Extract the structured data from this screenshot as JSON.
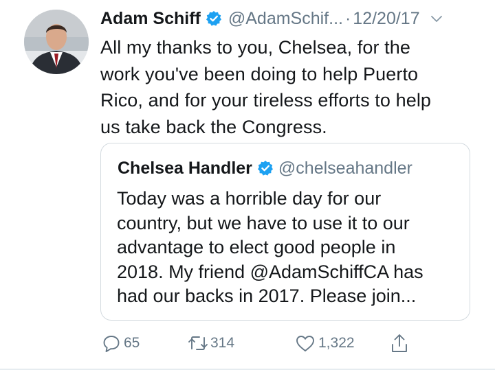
{
  "tweet": {
    "author_name": "Adam Schiff",
    "author_handle": "@AdamSchif...",
    "separator": "·",
    "date": "12/20/17",
    "text": "All my thanks to you, Chelsea, for the\nwork you've been doing to help Puerto\nRico, and for your tireless efforts to help\nus take back the Congress."
  },
  "quoted_tweet": {
    "author_name": "Chelsea Handler",
    "author_handle": "@chelseahandler",
    "text": "Today was a horrible day for our\ncountry, but we have to use it to our\nadvantage to elect good people in\n2018. My friend @AdamSchiffCA has\nhad our backs in 2017. Please join..."
  },
  "actions": {
    "replies": "65",
    "retweets": "314",
    "likes": "1,322"
  },
  "icons": {
    "verified": "verified-badge-icon",
    "caret": "chevron-down-icon",
    "reply": "reply-icon",
    "retweet": "retweet-icon",
    "like": "heart-icon",
    "share": "share-icon"
  },
  "colors": {
    "verified_blue": "#1da1f2",
    "secondary_text": "#657786",
    "border": "#d3dadf"
  }
}
